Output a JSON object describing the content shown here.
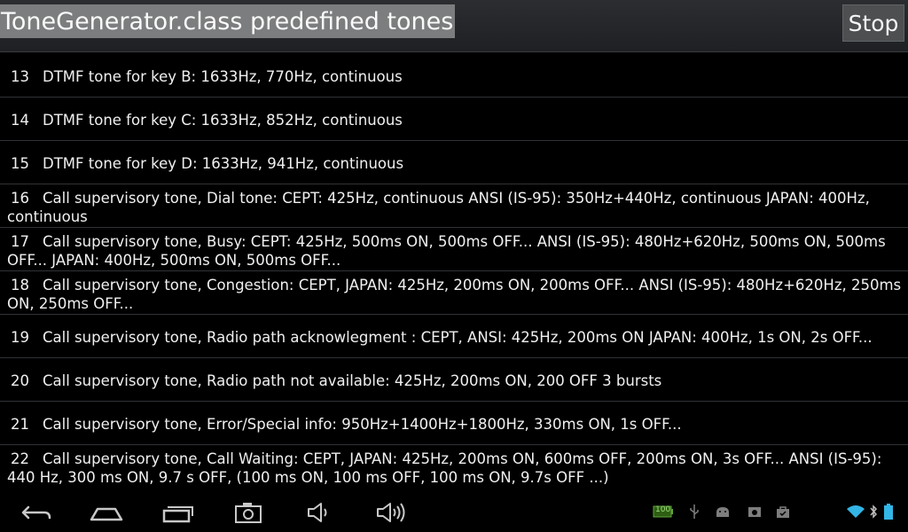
{
  "header": {
    "title": "ToneGenerator.class predefined tones",
    "stop_label": "Stop"
  },
  "tones": [
    {
      "num": "13",
      "text": "DTMF tone for key B: 1633Hz, 770Hz, continuous"
    },
    {
      "num": "14",
      "text": "DTMF tone for key C: 1633Hz, 852Hz, continuous"
    },
    {
      "num": "15",
      "text": "DTMF tone for key D: 1633Hz, 941Hz, continuous"
    },
    {
      "num": "16",
      "text": "Call supervisory tone, Dial tone: CEPT: 425Hz, continuous ANSI (IS-95): 350Hz+440Hz, continuous JAPAN: 400Hz, continuous"
    },
    {
      "num": "17",
      "text": "Call supervisory tone, Busy: CEPT: 425Hz, 500ms ON, 500ms OFF... ANSI (IS-95): 480Hz+620Hz, 500ms ON, 500ms OFF... JAPAN: 400Hz, 500ms ON, 500ms OFF..."
    },
    {
      "num": "18",
      "text": "Call supervisory tone, Congestion: CEPT, JAPAN: 425Hz, 200ms ON, 200ms OFF... ANSI (IS-95): 480Hz+620Hz, 250ms ON, 250ms OFF..."
    },
    {
      "num": "19",
      "text": "Call supervisory tone, Radio path acknowlegment : CEPT, ANSI: 425Hz, 200ms ON JAPAN: 400Hz, 1s ON, 2s OFF..."
    },
    {
      "num": "20",
      "text": "Call supervisory tone, Radio path not available: 425Hz, 200ms ON, 200 OFF 3 bursts"
    },
    {
      "num": "21",
      "text": "Call supervisory tone, Error/Special info: 950Hz+1400Hz+1800Hz, 330ms ON, 1s OFF..."
    },
    {
      "num": "22",
      "text": "Call supervisory tone, Call Waiting: CEPT, JAPAN: 425Hz, 200ms ON, 600ms OFF, 200ms ON, 3s OFF... ANSI (IS-95): 440 Hz, 300 ms ON, 9.7 s OFF, (100 ms ON, 100 ms OFF, 100 ms ON, 9.7s OFF ...)"
    }
  ],
  "status": {
    "battery_level": "100",
    "accent_color": "#33b5e5",
    "icon_color": "#8a8a8a"
  },
  "nav_icons": [
    "back-icon",
    "home-icon",
    "recent-apps-icon",
    "screenshot-icon",
    "volume-down-icon",
    "volume-up-icon"
  ]
}
